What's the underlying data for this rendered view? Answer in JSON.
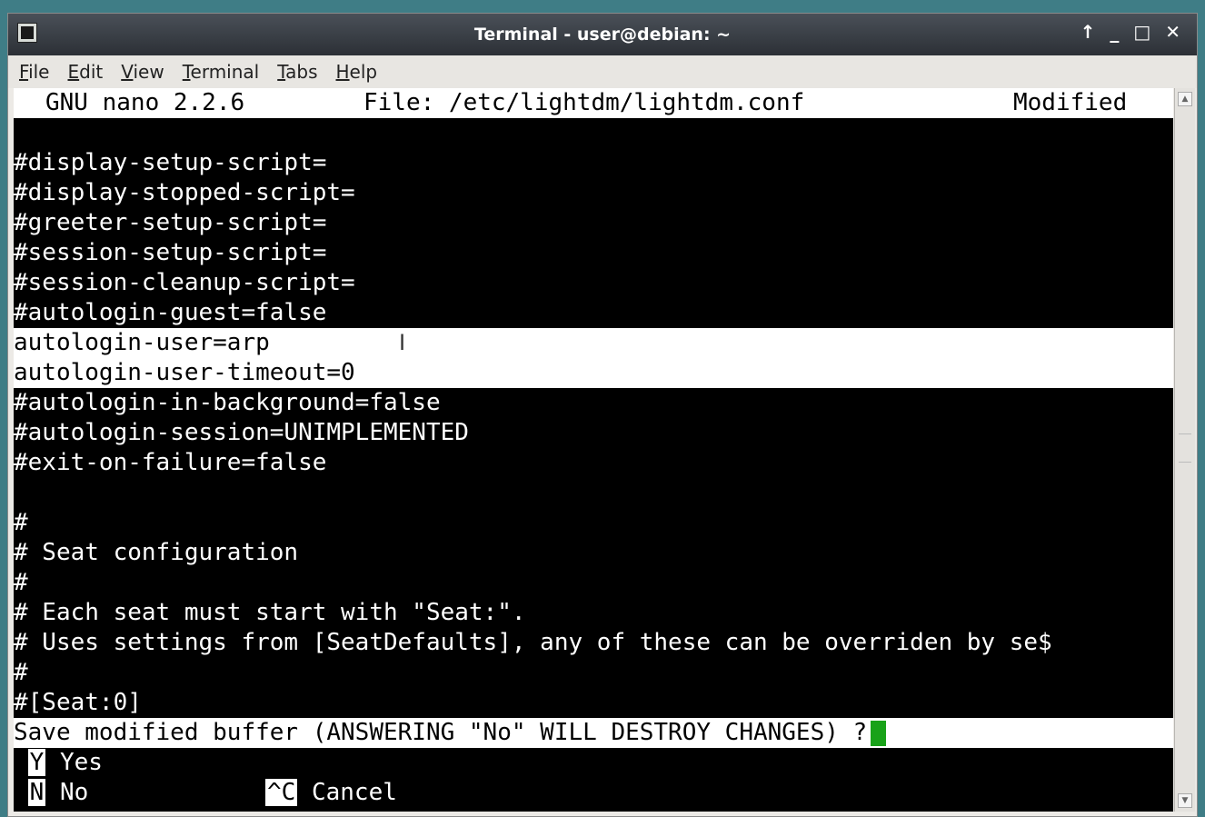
{
  "window": {
    "title": "Terminal - user@debian: ~",
    "controls": [
      "↑",
      "_",
      "□",
      "✕"
    ]
  },
  "menu": [
    "File",
    "Edit",
    "View",
    "Terminal",
    "Tabs",
    "Help"
  ],
  "nano": {
    "version": "GNU nano 2.2.6",
    "file": "File: /etc/lightdm/lightdm.conf",
    "status": "Modified"
  },
  "lines": [
    "",
    "#display-setup-script=",
    "#display-stopped-script=",
    "#greeter-setup-script=",
    "#session-setup-script=",
    "#session-cleanup-script=",
    "#autologin-guest=false",
    "autologin-user=arp",
    "autologin-user-timeout=0",
    "#autologin-in-background=false",
    "#autologin-session=UNIMPLEMENTED",
    "#exit-on-failure=false",
    "",
    "#",
    "# Seat configuration",
    "#",
    "# Each seat must start with \"Seat:\".",
    "# Uses settings from [SeatDefaults], any of these can be overriden by se$",
    "#",
    "#[Seat:0]"
  ],
  "prompt": "Save modified buffer (ANSWERING \"No\" WILL DESTROY CHANGES) ?",
  "options": {
    "yes_key": "Y",
    "yes_label": "Yes",
    "no_key": "N",
    "no_label": "No",
    "cancel_key": "^C",
    "cancel_label": "Cancel"
  },
  "colors": {
    "cursor": "#19a219",
    "terminal_bg": "#000000"
  }
}
